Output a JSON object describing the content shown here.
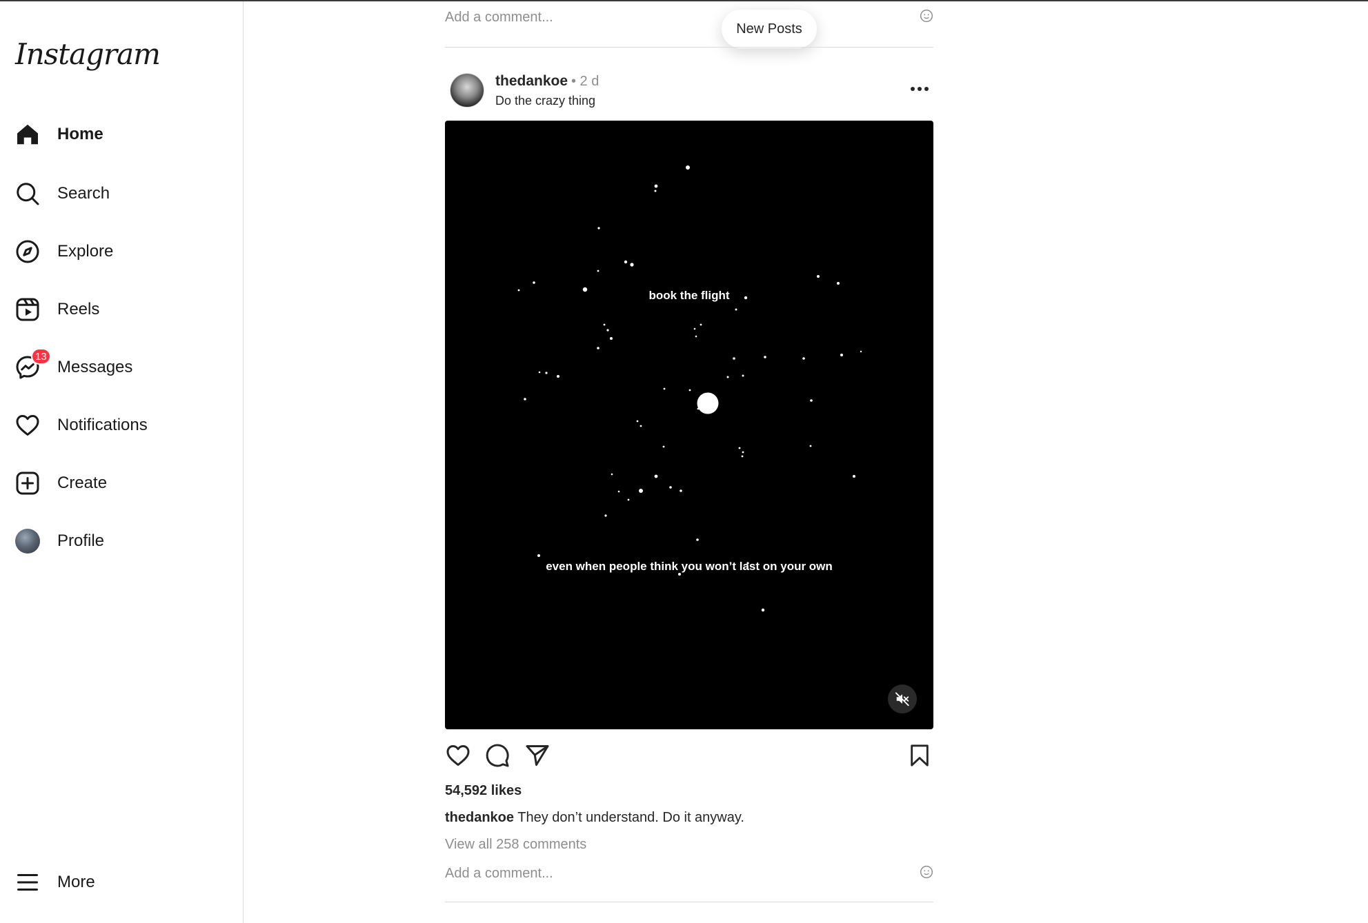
{
  "app": {
    "logo_text": "Instagram"
  },
  "sidebar": {
    "items": [
      {
        "label": "Home",
        "icon": "home-icon",
        "active": true
      },
      {
        "label": "Search",
        "icon": "search-icon"
      },
      {
        "label": "Explore",
        "icon": "compass-icon"
      },
      {
        "label": "Reels",
        "icon": "reels-icon"
      },
      {
        "label": "Messages",
        "icon": "messenger-icon",
        "badge": "13"
      },
      {
        "label": "Notifications",
        "icon": "heart-icon"
      },
      {
        "label": "Create",
        "icon": "plus-square-icon"
      },
      {
        "label": "Profile",
        "icon": "avatar"
      }
    ],
    "more_label": "More"
  },
  "feed": {
    "new_posts_label": "New Posts",
    "prev_post": {
      "comment_placeholder": "Add a comment..."
    },
    "post": {
      "username": "thedankoe",
      "time": "• 2 d",
      "subtitle": "Do the crazy thing",
      "media": {
        "text_top": "book the flight",
        "text_bottom": "even when people think you won’t last on your own",
        "muted": true
      },
      "likes": "54,592 likes",
      "caption_user": "thedankoe",
      "caption_text": "They don’t understand. Do it anyway.",
      "view_comments": "View all 258 comments",
      "comment_placeholder": "Add a comment..."
    }
  },
  "colors": {
    "badge": "#ff3040",
    "border": "#dbdbdb",
    "muted_text": "#8e8e8e"
  }
}
